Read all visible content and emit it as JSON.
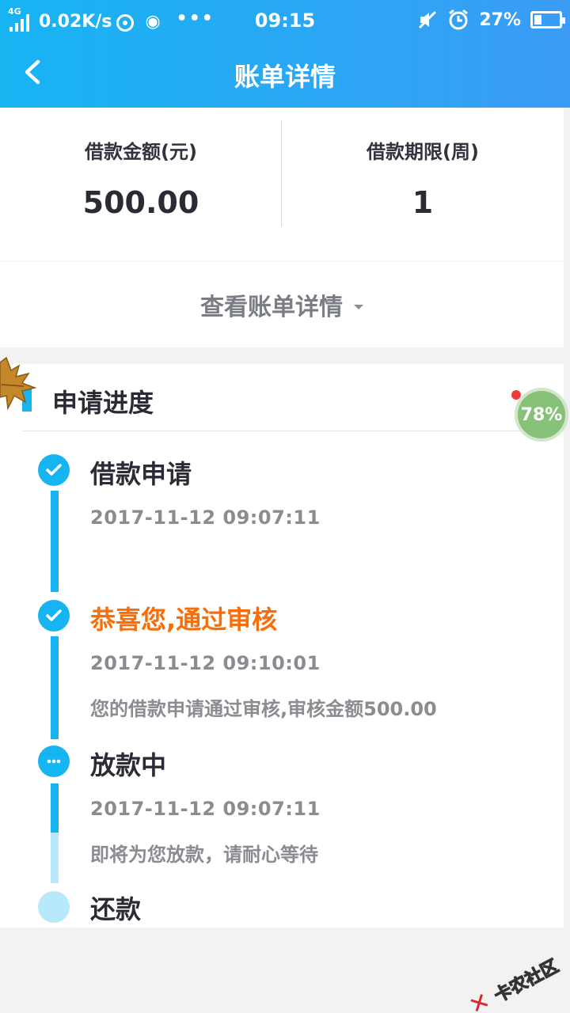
{
  "status_bar": {
    "network": "4G",
    "speed": "0.02K/s",
    "time": "09:15",
    "battery": "27%"
  },
  "app_bar": {
    "title": "账单详情"
  },
  "summary": {
    "amount_label": "借款金额(元)",
    "amount_value": "500.00",
    "term_label": "借款期限(周)",
    "term_value": "1"
  },
  "bill_toggle": {
    "label": "查看账单详情"
  },
  "progress": {
    "title": "申请进度",
    "steps": [
      {
        "title": "借款申请",
        "time": "2017-11-12 09:07:11",
        "desc": "",
        "status": "done"
      },
      {
        "title": "恭喜您,通过审核",
        "time": "2017-11-12 09:10:01",
        "desc": "您的借款申请通过审核,审核金额500.00",
        "status": "done"
      },
      {
        "title": "放款中",
        "time": "2017-11-12 09:07:11",
        "desc": "即将为您放款，请耐心等待",
        "status": "in-progress"
      },
      {
        "title": "还款",
        "time": "",
        "desc": "",
        "status": "pending"
      }
    ]
  },
  "overlay": {
    "badge": "78%",
    "watermark": "卡农社区"
  },
  "colors": {
    "primary": "#17b4f2",
    "highlight": "#fa6e0a",
    "pending": "#b7e9fb"
  }
}
